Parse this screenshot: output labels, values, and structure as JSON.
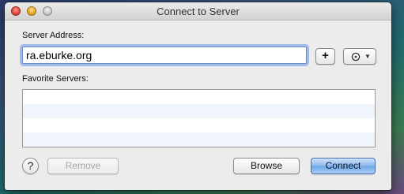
{
  "window": {
    "title": "Connect to Server"
  },
  "server_address": {
    "label": "Server Address:",
    "value": "ra.eburke.org"
  },
  "buttons": {
    "add_label": "+",
    "help_label": "?",
    "remove_label": "Remove",
    "browse_label": "Browse",
    "connect_label": "Connect"
  },
  "icons": {
    "action": "gear-icon",
    "action_menu": "chevron-down-icon"
  },
  "favorites": {
    "label": "Favorite Servers:",
    "items": []
  },
  "colors": {
    "focus_ring": "#6496e6",
    "default_button": "#8ab7ec"
  }
}
